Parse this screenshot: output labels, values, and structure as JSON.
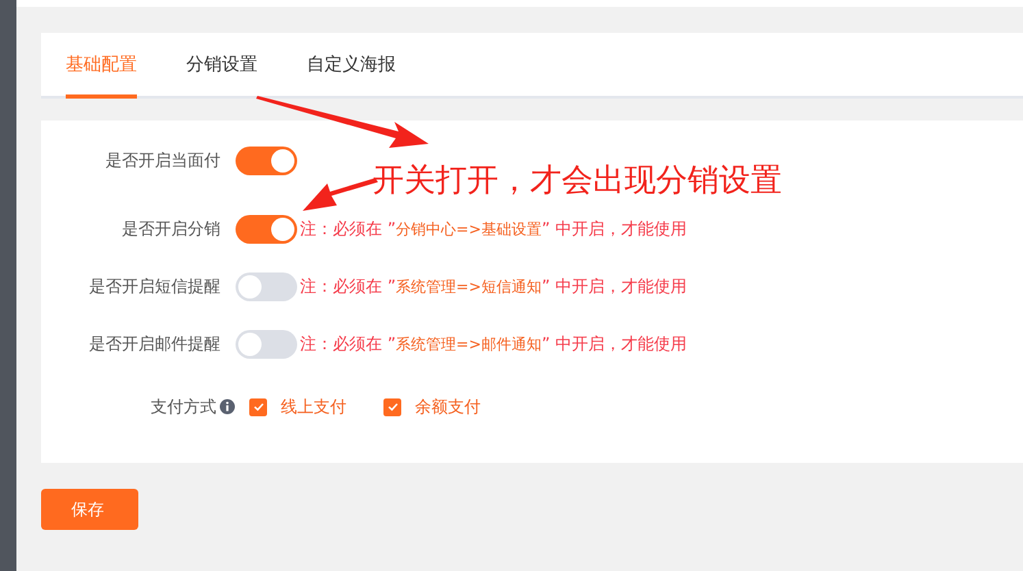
{
  "tabs": [
    {
      "label": "基础配置",
      "selected": true
    },
    {
      "label": "分销设置",
      "selected": false
    },
    {
      "label": "自定义海报",
      "selected": false
    }
  ],
  "switches": [
    {
      "label": "是否开启当面付",
      "on": true
    },
    {
      "label": "是否开启分销",
      "on": true,
      "note": {
        "prefix": "注：必须在 ”",
        "path": "分销中心=>基础设置",
        "suffix": "” 中开启，才能使用"
      }
    },
    {
      "label": "是否开启短信提醒",
      "on": false,
      "note": {
        "prefix": "注：必须在 ”",
        "path": "系统管理=>短信通知",
        "suffix": "” 中开启，才能使用"
      }
    },
    {
      "label": "是否开启邮件提醒",
      "on": false,
      "note": {
        "prefix": "注：必须在 ”",
        "path": "系统管理=>邮件通知",
        "suffix": "” 中开启，才能使用"
      }
    }
  ],
  "payment": {
    "label": "支付方式",
    "options": [
      {
        "label": "线上支付",
        "checked": true
      },
      {
        "label": "余额支付",
        "checked": true
      }
    ]
  },
  "save_button": "保存",
  "annotation": "开关打开，才会出现分销设置"
}
